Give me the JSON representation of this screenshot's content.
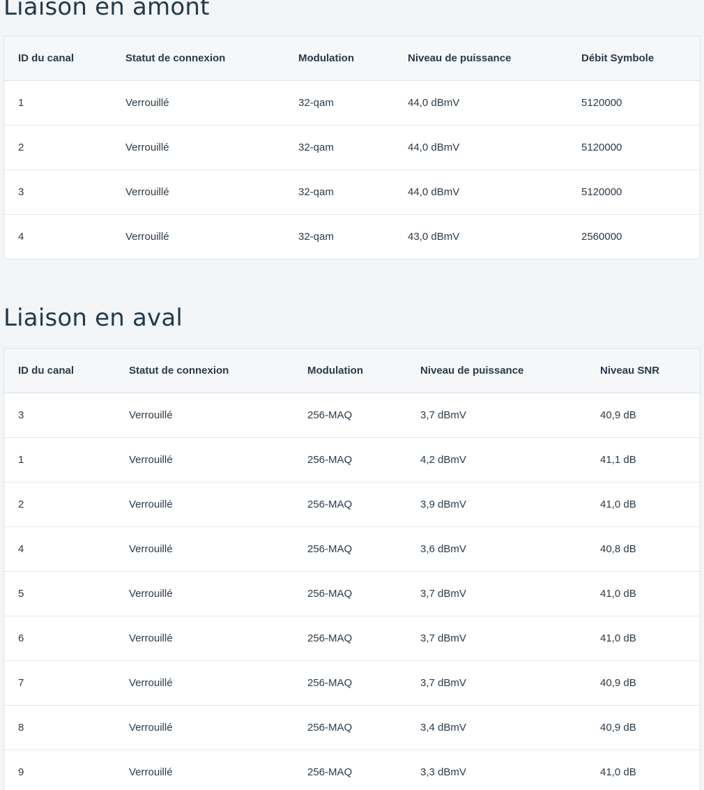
{
  "upstream": {
    "title": "Liaison en amont",
    "headers": [
      "ID du canal",
      "Statut de connexion",
      "Modulation",
      "Niveau de puissance",
      "Débit Symbole"
    ],
    "rows": [
      [
        "1",
        "Verrouillé",
        "32-qam",
        "44,0 dBmV",
        "5120000"
      ],
      [
        "2",
        "Verrouillé",
        "32-qam",
        "44,0 dBmV",
        "5120000"
      ],
      [
        "3",
        "Verrouillé",
        "32-qam",
        "44,0 dBmV",
        "5120000"
      ],
      [
        "4",
        "Verrouillé",
        "32-qam",
        "43,0 dBmV",
        "2560000"
      ]
    ]
  },
  "downstream": {
    "title": "Liaison en aval",
    "headers": [
      "ID du canal",
      "Statut de connexion",
      "Modulation",
      "Niveau de puissance",
      "Niveau SNR"
    ],
    "rows": [
      [
        "3",
        "Verrouillé",
        "256-MAQ",
        "3,7 dBmV",
        "40,9 dB"
      ],
      [
        "1",
        "Verrouillé",
        "256-MAQ",
        "4,2 dBmV",
        "41,1 dB"
      ],
      [
        "2",
        "Verrouillé",
        "256-MAQ",
        "3,9 dBmV",
        "41,0 dB"
      ],
      [
        "4",
        "Verrouillé",
        "256-MAQ",
        "3,6 dBmV",
        "40,8 dB"
      ],
      [
        "5",
        "Verrouillé",
        "256-MAQ",
        "3,7 dBmV",
        "41,0 dB"
      ],
      [
        "6",
        "Verrouillé",
        "256-MAQ",
        "3,7 dBmV",
        "41,0 dB"
      ],
      [
        "7",
        "Verrouillé",
        "256-MAQ",
        "3,7 dBmV",
        "40,9 dB"
      ],
      [
        "8",
        "Verrouillé",
        "256-MAQ",
        "3,4 dBmV",
        "40,9 dB"
      ],
      [
        "9",
        "Verrouillé",
        "256-MAQ",
        "3,3 dBmV",
        "41,0 dB"
      ]
    ]
  }
}
